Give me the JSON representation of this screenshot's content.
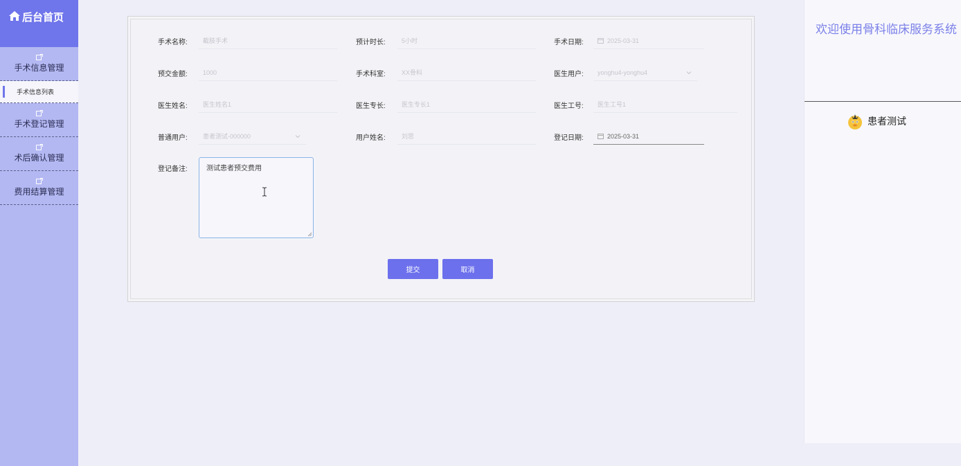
{
  "sidebar": {
    "brand_label": "后台首页",
    "brand_icon": "home-icon",
    "items": [
      {
        "label": "手术信息管理",
        "icon": "edit-icon"
      },
      {
        "label": "手术信息列表"
      },
      {
        "label": "手术登记管理",
        "icon": "edit-icon"
      },
      {
        "label": "术后确认管理",
        "icon": "edit-icon"
      },
      {
        "label": "费用结算管理",
        "icon": "edit-icon"
      }
    ],
    "active_item": "手术信息列表",
    "colors": {
      "background": "#b3b8f2",
      "brand": "#6f75ea"
    }
  },
  "header": {
    "welcome": "欢迎使用骨科临床服务系统",
    "user_name": "患者测试",
    "avatar_icon": "cartoon-avatar-icon"
  },
  "form": {
    "fields": {
      "surgery_name": {
        "label": "手术名称:",
        "value": "截肢手术"
      },
      "duration": {
        "label": "预计时长:",
        "value": "5小时"
      },
      "surgery_date": {
        "label": "手术日期:",
        "value": "2025-03-31"
      },
      "deposit": {
        "label": "预交金额:",
        "value": "1000"
      },
      "department": {
        "label": "手术科室:",
        "value": "XX骨科"
      },
      "doctor_user": {
        "label": "医生用户:",
        "value": "yonghu4-yonghu4"
      },
      "doctor_name": {
        "label": "医生姓名:",
        "value": "医生姓名1"
      },
      "doctor_specialty": {
        "label": "医生专长:",
        "value": "医生专长1"
      },
      "doctor_id": {
        "label": "医生工号:",
        "value": "医生工号1"
      },
      "patient_user": {
        "label": "普通用户:",
        "value": "患者测试-000000"
      },
      "patient_name": {
        "label": "用户姓名:",
        "value": "刘思"
      },
      "register_date": {
        "label": "登记日期:",
        "value": "2025-03-31"
      },
      "remark": {
        "label": "登记备注:",
        "value": "测试患者预交费用"
      }
    },
    "submit_label": "提交",
    "cancel_label": "取消",
    "accent_color": "#6c70ec"
  }
}
